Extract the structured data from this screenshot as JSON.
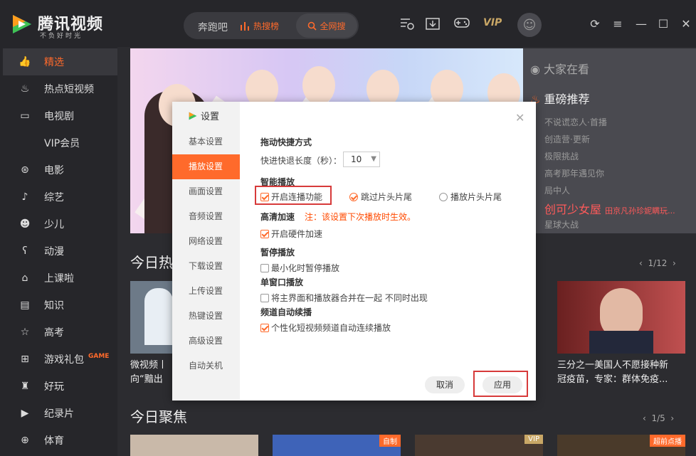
{
  "app": {
    "logo_text": "腾讯视频",
    "logo_sub": "不负好时光",
    "vip_label": "VIP"
  },
  "search": {
    "query": "奔跑吧",
    "hot_label": "热搜榜",
    "all_label": "全网搜"
  },
  "sidebar": {
    "items": [
      {
        "label": "精选",
        "icon": "thumb-up-icon"
      },
      {
        "label": "热点短视频",
        "icon": "flame-icon"
      },
      {
        "label": "电视剧",
        "icon": "tv-icon"
      },
      {
        "label": "VIP会员",
        "icon": ""
      },
      {
        "label": "电影",
        "icon": "film-reel-icon"
      },
      {
        "label": "综艺",
        "icon": "microphone-icon"
      },
      {
        "label": "少儿",
        "icon": "kid-icon"
      },
      {
        "label": "动漫",
        "icon": "bear-icon"
      },
      {
        "label": "上课啦",
        "icon": "graduation-icon"
      },
      {
        "label": "知识",
        "icon": "book-icon"
      },
      {
        "label": "高考",
        "icon": "star-icon"
      },
      {
        "label": "游戏礼包",
        "icon": "gamepad-icon",
        "badge": "GAME"
      },
      {
        "label": "好玩",
        "icon": "joystick-icon"
      },
      {
        "label": "纪录片",
        "icon": "camera-icon"
      },
      {
        "label": "体育",
        "icon": "ball-icon"
      }
    ]
  },
  "side_panel": {
    "watching": "大家在看",
    "featured": "重磅推荐",
    "items": [
      "不说谎恋人·首播",
      "创造营·更新",
      "极限挑战",
      "高考那年遇见你",
      "局中人"
    ],
    "highlight": "创可少女屋",
    "highlight_sub": "田京凡孙珍妮瞒玩...",
    "last": "星球大战"
  },
  "sections": {
    "hot_title": "今日热",
    "hot_pager": "1/12",
    "focus_title": "今日聚焦",
    "focus_pager": "1/5",
    "captions": {
      "left_line1": "微视频丨",
      "left_line2": "向“黯出",
      "right_line1": "三分之一美国人不愿接种新",
      "right_line2": "冠疫苗，专家：群体免疫..."
    },
    "tags": [
      "自制",
      "VIP",
      "超前点播"
    ]
  },
  "dialog": {
    "title": "设置",
    "tabs": [
      "基本设置",
      "播放设置",
      "画面设置",
      "音频设置",
      "网络设置",
      "下载设置",
      "上传设置",
      "热键设置",
      "高级设置",
      "自动关机"
    ],
    "drag_heading": "拖动快捷方式",
    "seek_label": "快进快退长度（秒）：",
    "seek_value": "10",
    "smart_heading": "智能播放",
    "autoplay_label": "开启连播功能",
    "skip_label": "跳过片头片尾",
    "play_label": "播放片头片尾",
    "hw_heading": "高清加速",
    "hw_note": "注：该设置下次播放时生效。",
    "hw_label": "开启硬件加速",
    "pause_heading": "暂停播放",
    "pause_label": "最小化时暂停播放",
    "single_heading": "单窗口播放",
    "single_label": "将主界面和播放器合并在一起 不同时出现",
    "channel_heading": "频道自动续播",
    "channel_label": "个性化短视频频道自动连续播放",
    "cancel_label": "取消",
    "apply_label": "应用"
  }
}
